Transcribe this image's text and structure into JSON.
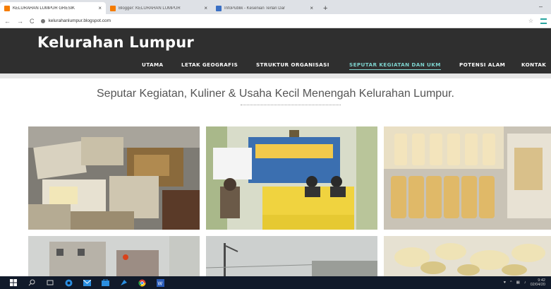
{
  "browser": {
    "tabs": [
      {
        "title": "KELURAHAN LUMPUR GRESIK",
        "favicon_color": "#f57c00",
        "active": true
      },
      {
        "title": "Blogger: KELURAHAN LUMPUR",
        "favicon_color": "#f57c00",
        "active": false
      },
      {
        "title": "InfoPublik - Kesenian Terlari Dar",
        "favicon_color": "#3a6fc4",
        "active": false
      }
    ],
    "new_tab": "+",
    "close_glyph": "×",
    "window_min": "–",
    "back": "←",
    "forward": "→",
    "reload": "C",
    "url": "kelurahanlumpur.blogspot.com",
    "bookmark": "☆"
  },
  "site": {
    "title": "Kelurahan Lumpur",
    "nav": [
      {
        "label": "UTAMA",
        "active": false
      },
      {
        "label": "LETAK GEOGRAFIS",
        "active": false
      },
      {
        "label": "STRUKTUR ORGANISASI",
        "active": false
      },
      {
        "label": "SEPUTAR KEGIATAN DAN UKM",
        "active": true
      },
      {
        "label": "POTENSI ALAM",
        "active": false
      },
      {
        "label": "KONTAK",
        "active": false
      }
    ],
    "accent": "#7dd3ce",
    "header_bg": "#2f2f2f"
  },
  "main": {
    "heading": "Seputar Kegiatan, Kuliner & Usaha Kecil Menengah Kelurahan Lumpur."
  },
  "gallery": [
    {
      "name": "photo-food-packages"
    },
    {
      "name": "photo-meeting-room"
    },
    {
      "name": "photo-crackers"
    },
    {
      "name": "photo-building"
    },
    {
      "name": "photo-street"
    },
    {
      "name": "photo-chips"
    }
  ],
  "taskbar": {
    "icons": [
      "windows-icon",
      "search-icon",
      "task-view-icon",
      "edge-icon",
      "mail-icon",
      "store-icon",
      "explorer-icon",
      "chrome-icon",
      "word-icon"
    ],
    "clock_time": "9:42",
    "clock_date": "02/04/20"
  }
}
